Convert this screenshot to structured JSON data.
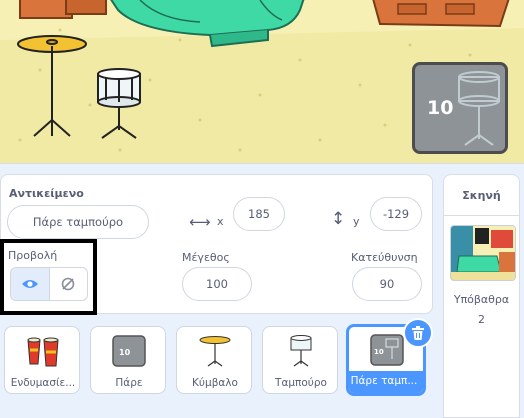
{
  "stage_thumb": {
    "number": "10"
  },
  "sprite_info": {
    "sprite_label": "Αντικείμενο",
    "sprite_name": "Πάρε ταμπούρο",
    "x_label": "x",
    "x_value": "185",
    "y_label": "y",
    "y_value": "-129",
    "show_label": "Προβολή",
    "size_label": "Μέγεθος",
    "size_value": "100",
    "direction_label": "Κατεύθυνση",
    "direction_value": "90"
  },
  "stage_panel": {
    "title": "Σκηνή",
    "backdrops_label": "Υπόβαθρα",
    "backdrops_count": "2"
  },
  "sprites": [
    {
      "name": "Ενδυμασίε...",
      "icon": "conga-drums-icon",
      "selected": false
    },
    {
      "name": "Πάρε",
      "icon": "grey-button-10-icon",
      "selected": false
    },
    {
      "name": "Κύμβαλο",
      "icon": "cymbal-icon",
      "selected": false
    },
    {
      "name": "Ταμπούρο",
      "icon": "snare-drum-icon",
      "selected": false
    },
    {
      "name": "Πάρε ταμπ...",
      "icon": "grey-button-drum-icon",
      "selected": true
    }
  ],
  "colors": {
    "accent": "#4c97ff",
    "stage_wall": "#f6f0b5",
    "bed": "#3fd9a6",
    "furniture": "#d8743c"
  }
}
